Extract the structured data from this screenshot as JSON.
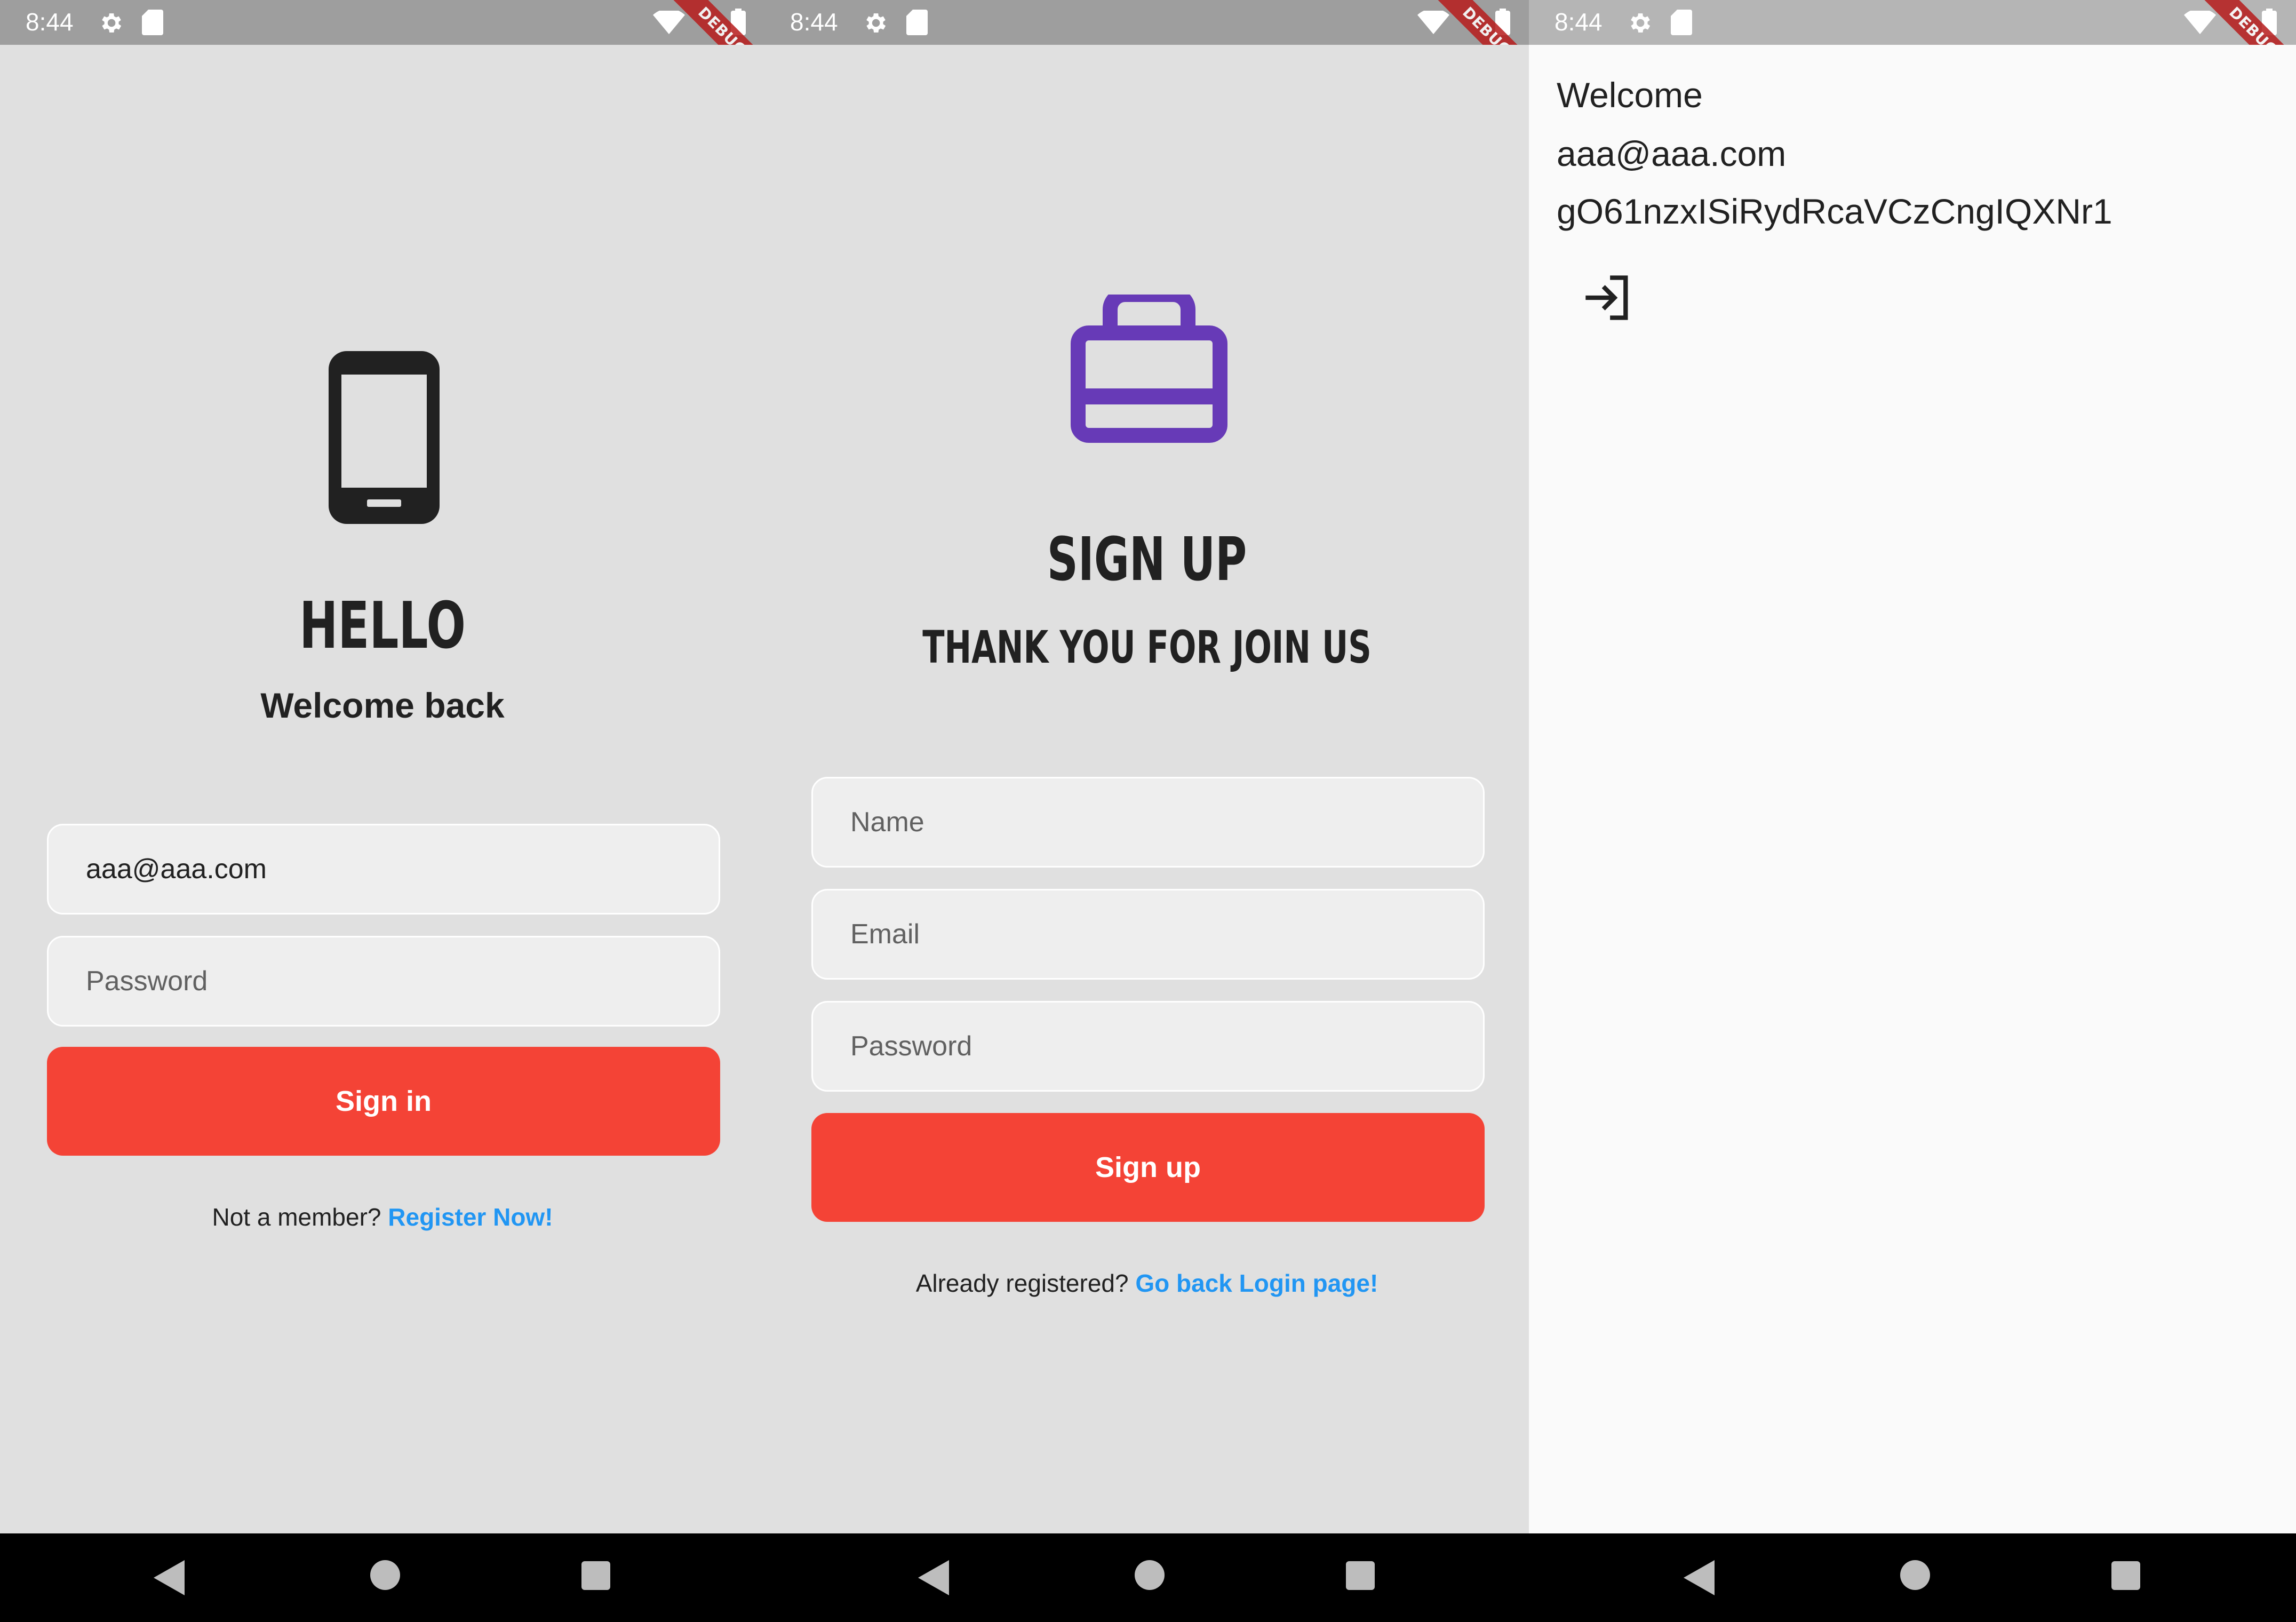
{
  "status_bar": {
    "time": "8:44",
    "debug_label": "DEBUG"
  },
  "login": {
    "icon": "phone-icon",
    "title": "HELLO",
    "subtitle": "Welcome back",
    "email_value": "aaa@aaa.com",
    "password_placeholder": "Password",
    "signin_label": "Sign in",
    "footer_prompt": "Not a member?",
    "footer_link": "Register Now!"
  },
  "signup": {
    "icon": "briefcase-icon",
    "title": "SIGN UP",
    "subtitle": "THANK YOU FOR JOIN US",
    "name_placeholder": "Name",
    "email_placeholder": "Email",
    "password_placeholder": "Password",
    "signup_label": "Sign up",
    "footer_prompt": "Already registered?",
    "footer_link": "Go back Login page!"
  },
  "home": {
    "welcome": "Welcome",
    "email": "aaa@aaa.com",
    "uid": "gO61nzxISiRydRcaVCzCngIQXNr1",
    "logout_icon": "logout-icon"
  },
  "colors": {
    "accent_red": "#f44336",
    "link_blue": "#2196f3",
    "icon_purple": "#673ab7",
    "screen_bg": "#e0e0e0",
    "home_bg": "#fafafa"
  }
}
